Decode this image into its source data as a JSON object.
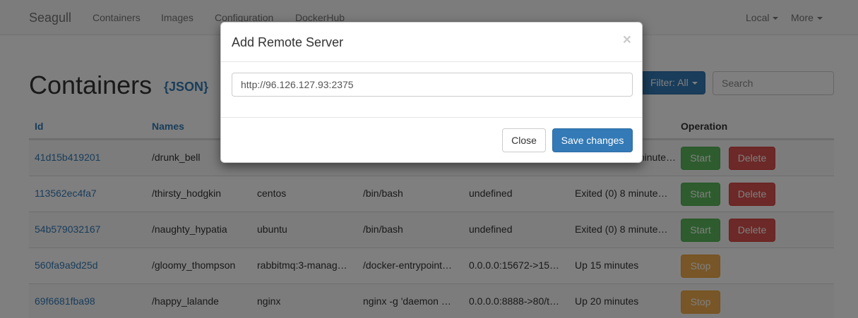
{
  "navbar": {
    "brand": "Seagull",
    "links": [
      "Containers",
      "Images",
      "Configuration",
      "DockerHub"
    ],
    "local": "Local",
    "more": "More"
  },
  "page": {
    "title": "Containers",
    "json_link": "{JSON}",
    "filter_label": "Filter: All",
    "search_placeholder": "Search"
  },
  "table": {
    "headers": {
      "id": "Id",
      "names": "Names",
      "operation": "Operation"
    },
    "rows": [
      {
        "id": "41d15b419201",
        "name": "/drunk_bell",
        "image": "",
        "command": "",
        "ports": "",
        "status": "minute…",
        "actions": [
          "Start",
          "Delete"
        ]
      },
      {
        "id": "113562ec4fa7",
        "name": "/thirsty_hodgkin",
        "image": "centos",
        "command": "/bin/bash",
        "ports": "undefined",
        "status": "Exited (0) 8 minute…",
        "actions": [
          "Start",
          "Delete"
        ]
      },
      {
        "id": "54b579032167",
        "name": "/naughty_hypatia",
        "image": "ubuntu",
        "command": "/bin/bash",
        "ports": "undefined",
        "status": "Exited (0) 8 minute…",
        "actions": [
          "Start",
          "Delete"
        ]
      },
      {
        "id": "560fa9a9d25d",
        "name": "/gloomy_thompson",
        "image": "rabbitmq:3-manag…",
        "command": "/docker-entrypoint…",
        "ports": "0.0.0.0:15672->15…",
        "status": "Up 15 minutes",
        "actions": [
          "Stop"
        ]
      },
      {
        "id": "69f6681fba98",
        "name": "/happy_lalande",
        "image": "nginx",
        "command": "nginx -g 'daemon …",
        "ports": "0.0.0.0:8888->80/t…",
        "status": "Up 20 minutes",
        "actions": [
          "Stop"
        ]
      }
    ]
  },
  "modal": {
    "title": "Add Remote Server",
    "close_symbol": "×",
    "input_value": "http://96.126.127.93:2375",
    "close_label": "Close",
    "save_label": "Save changes"
  }
}
